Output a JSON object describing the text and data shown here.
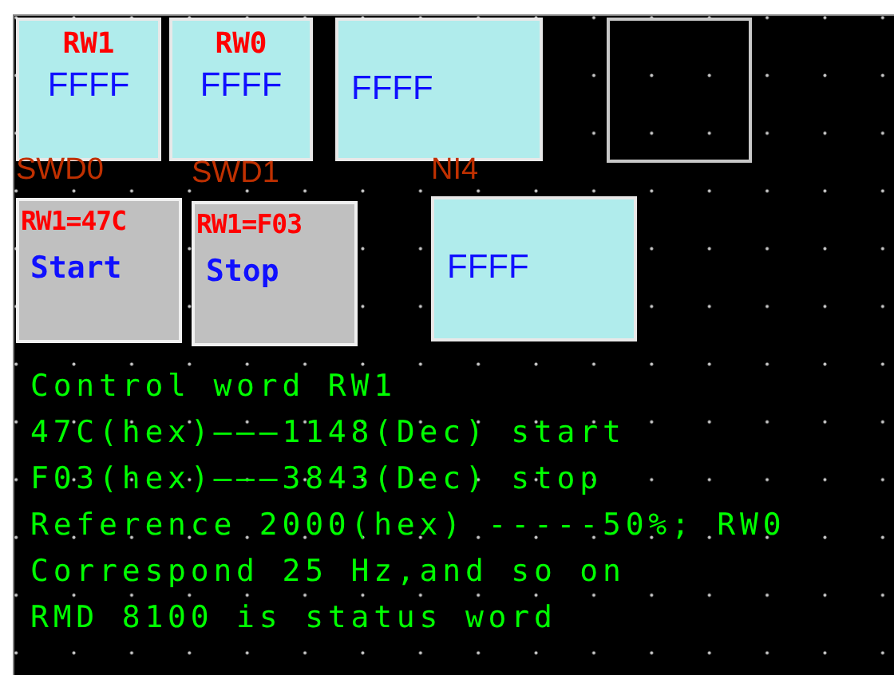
{
  "displays": [
    {
      "title": "RW1",
      "value": "FFFF"
    },
    {
      "title": "RW0",
      "value": "FFFF"
    },
    {
      "value": "FFFF"
    },
    {
      "value": "FFFF"
    }
  ],
  "tag_labels": [
    "SWD0",
    "SWD1",
    "NI4"
  ],
  "buttons": [
    {
      "caption": "RW1=47C",
      "label": "Start"
    },
    {
      "caption": "RW1=F03",
      "label": "Stop"
    }
  ],
  "notes": [
    "Control word RW1",
    "47C(hex)———1148(Dec) start",
    "F03(hex)———3843(Dec) stop",
    "Reference 2000(hex) -----50%; RW0",
    "Correspond 25 Hz,and so on",
    "RMD 8100 is status word"
  ]
}
